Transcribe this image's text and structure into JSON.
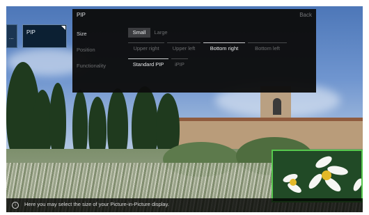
{
  "tiles": {
    "small_label": "...",
    "pip_label": "PIP"
  },
  "panel": {
    "title": "PIP",
    "back": "Back",
    "rows": [
      {
        "label": "Size",
        "options": [
          "Small",
          "Large"
        ],
        "selected": "Small"
      },
      {
        "label": "Position",
        "options": [
          "Upper right",
          "Upper left",
          "Bottom right",
          "Bottom left"
        ],
        "selected": "Bottom right"
      },
      {
        "label": "Functionality",
        "options": [
          "Standard PIP",
          "iPIP"
        ],
        "selected": "Standard PIP"
      }
    ]
  },
  "info_bar": {
    "icon": "info-icon",
    "text": "Here you may select the size of your Picture-in-Picture display."
  },
  "colors": {
    "pip_border": "#56c84e",
    "panel_bg": "#0d0d0d",
    "selected_bg": "#3b3b3b"
  }
}
